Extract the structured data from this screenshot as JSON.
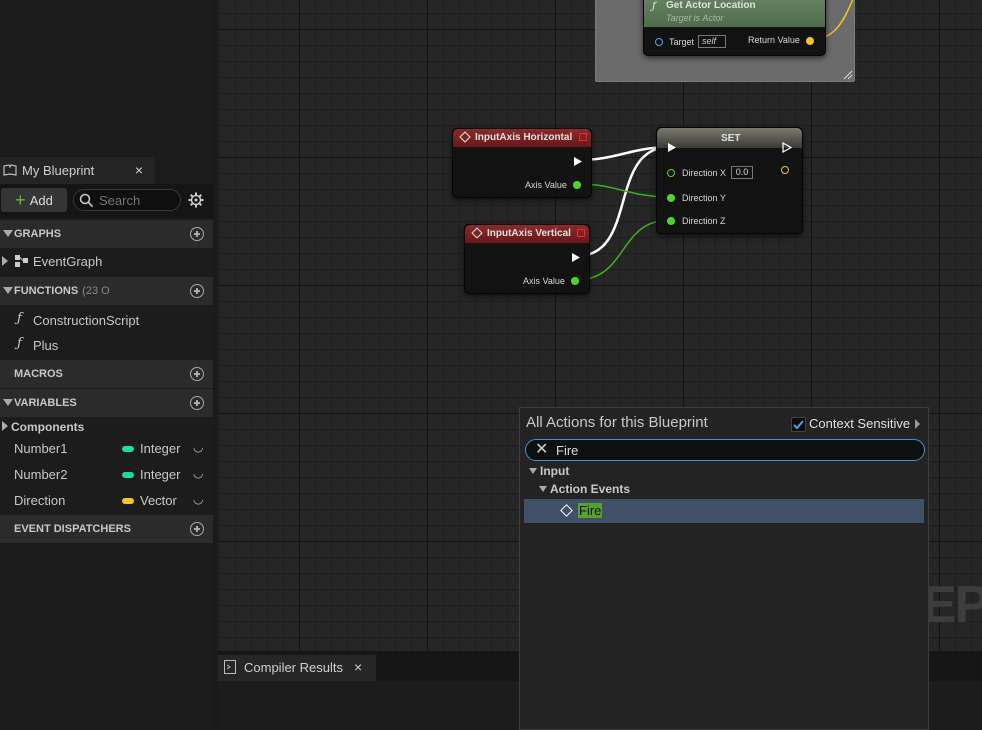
{
  "my_blueprint": {
    "tab_label": "My Blueprint",
    "add_label": "Add",
    "search_placeholder": "Search",
    "sections": {
      "graphs": {
        "label": "GRAPHS",
        "items": [
          "EventGraph"
        ]
      },
      "functions": {
        "label": "FUNCTIONS",
        "count": "(23 O",
        "items": [
          "ConstructionScript",
          "Plus"
        ]
      },
      "macros": {
        "label": "MACROS"
      },
      "variables": {
        "label": "VARIABLES",
        "category": "Components",
        "items": [
          {
            "name": "Number1",
            "type": "Integer",
            "color": "#1fd9a5"
          },
          {
            "name": "Number2",
            "type": "Integer",
            "color": "#1fd9a5"
          },
          {
            "name": "Direction",
            "type": "Vector",
            "color": "#f5c51f"
          }
        ]
      },
      "event_dispatchers": {
        "label": "EVENT DISPATCHERS"
      }
    }
  },
  "graph": {
    "nodes": {
      "get_actor_location": {
        "title": "Get Actor Location",
        "subtitle": "Target is Actor",
        "target_label": "Target",
        "target_value": "self",
        "return_label": "Return Value"
      },
      "input_axis_horizontal": {
        "title": "InputAxis Horizontal",
        "pin_label": "Axis Value"
      },
      "input_axis_vertical": {
        "title": "InputAxis Vertical",
        "pin_label": "Axis Value"
      },
      "set": {
        "title": "SET",
        "pins": {
          "x_label": "Direction X",
          "x_value": "0.0",
          "y_label": "Direction Y",
          "z_label": "Direction Z"
        }
      }
    },
    "watermark": "EP"
  },
  "compiler_results": {
    "tab_label": "Compiler Results"
  },
  "action_menu": {
    "title": "All Actions for this Blueprint",
    "context_sensitive_label": "Context Sensitive",
    "context_sensitive_checked": true,
    "search_value": "Fire",
    "tree": {
      "category": "Input",
      "subcategory": "Action Events",
      "selected_item": "Fire"
    }
  },
  "colors": {
    "accent_blue": "#4c8ed6",
    "selection": "#405066",
    "highlight_green": "#5aa02c",
    "event_node_red": "#7a1f1f",
    "float_pin_green": "#4cd62b",
    "vector_pin_yellow": "#f5c51f"
  }
}
